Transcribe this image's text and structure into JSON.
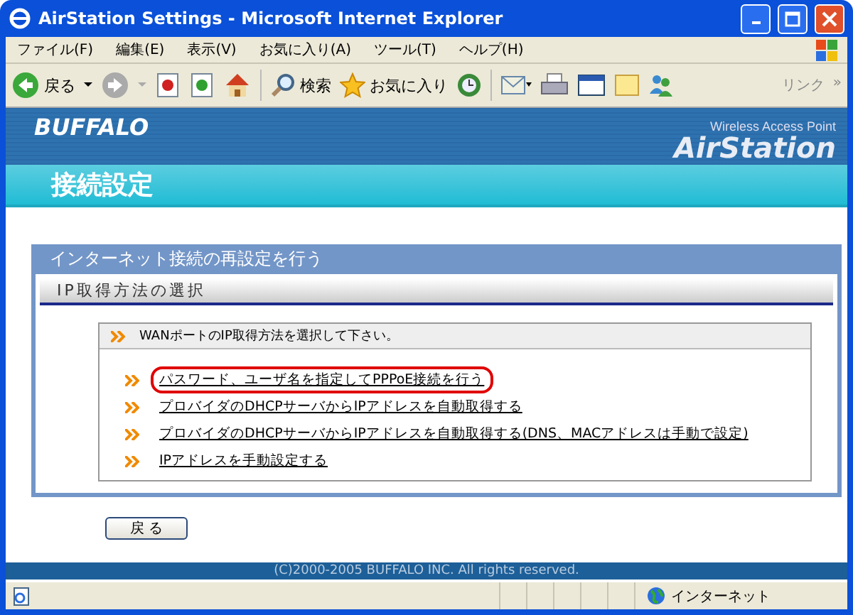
{
  "window": {
    "title": "AirStation Settings - Microsoft Internet Explorer"
  },
  "menu": [
    "ファイル(F)",
    "編集(E)",
    "表示(V)",
    "お気に入り(A)",
    "ツール(T)",
    "ヘルプ(H)"
  ],
  "toolbar": {
    "back": "戻る",
    "search": "検索",
    "favorites": "お気に入り",
    "links": "リンク",
    "more": "»"
  },
  "header": {
    "logo": "BUFFALO",
    "tagline": "Wireless Access Point",
    "product": "AirStation",
    "page_title": "接続設定"
  },
  "panel": {
    "title": "インターネット接続の再設定を行う",
    "subtitle": "IP取得方法の選択",
    "instruction": "WANポートのIP取得方法を選択して下さい。",
    "options": [
      {
        "label": "パスワード、ユーザ名を指定してPPPoE接続を行う",
        "highlighted": true
      },
      {
        "label": "プロバイダのDHCPサーバからIPアドレスを自動取得する",
        "highlighted": false
      },
      {
        "label": "プロバイダのDHCPサーバからIPアドレスを自動取得する(DNS、MACアドレスは手動で設定)",
        "highlighted": false
      },
      {
        "label": "IPアドレスを手動設定する",
        "highlighted": false
      }
    ]
  },
  "back_button": "戻 る",
  "footer": "(C)2000-2005 BUFFALO INC. All rights reserved.",
  "status_bar": {
    "zone": "インターネット"
  }
}
